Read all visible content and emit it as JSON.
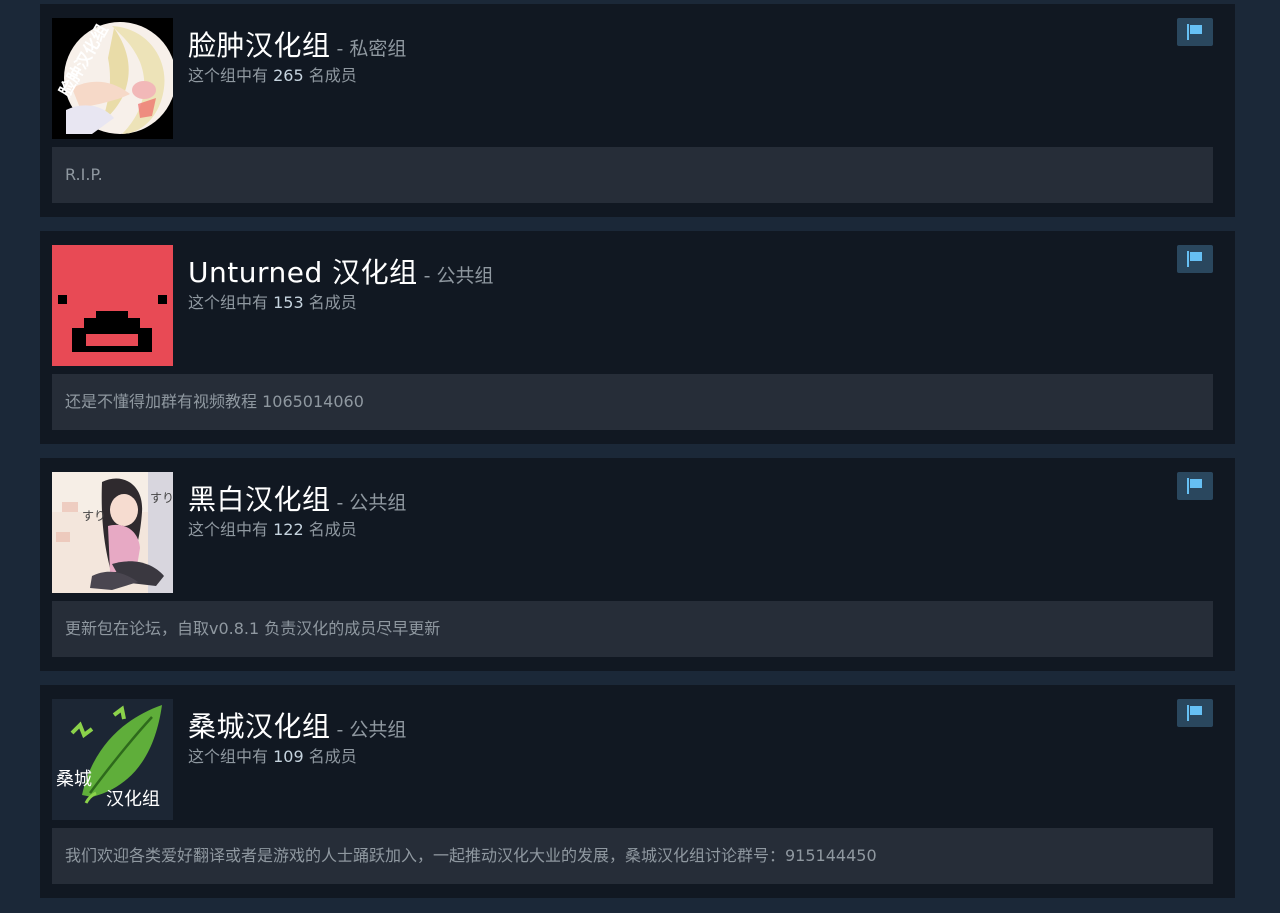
{
  "member_prefix": "这个组中有",
  "member_suffix": "名成员",
  "groups": [
    {
      "name": "脸肿汉化组",
      "type": "私密组",
      "members": "265",
      "description": "R.I.P.",
      "avatar_icon": "anime-girl-avatar",
      "avatar_text": "脸肿汉化组"
    },
    {
      "name": "Unturned 汉化组",
      "type": "公共组",
      "members": "153",
      "description": "还是不懂得加群有视频教程 1065014060",
      "avatar_icon": "pixel-face-avatar",
      "avatar_bg": "#e84a55"
    },
    {
      "name": "黑白汉化组",
      "type": "公共组",
      "members": "122",
      "description": "更新包在论坛，自取v0.8.1 负责汉化的成员尽早更新",
      "avatar_icon": "anime-girl-sitting-avatar"
    },
    {
      "name": "桑城汉化组",
      "type": "公共组",
      "members": "109",
      "description": "我们欢迎各类爱好翻译或者是游戏的人士踊跃加入，一起推动汉化大业的发展，桑城汉化组讨论群号：915144450",
      "avatar_icon": "green-leaf-logo-avatar",
      "avatar_text": "桑城汉化组"
    }
  ],
  "colors": {
    "page_bg": "#1b2838",
    "card_bg": "#111822",
    "desc_bg": "#262d38",
    "flag_bg": "#2a475e",
    "flag_fg": "#66c0f4"
  }
}
